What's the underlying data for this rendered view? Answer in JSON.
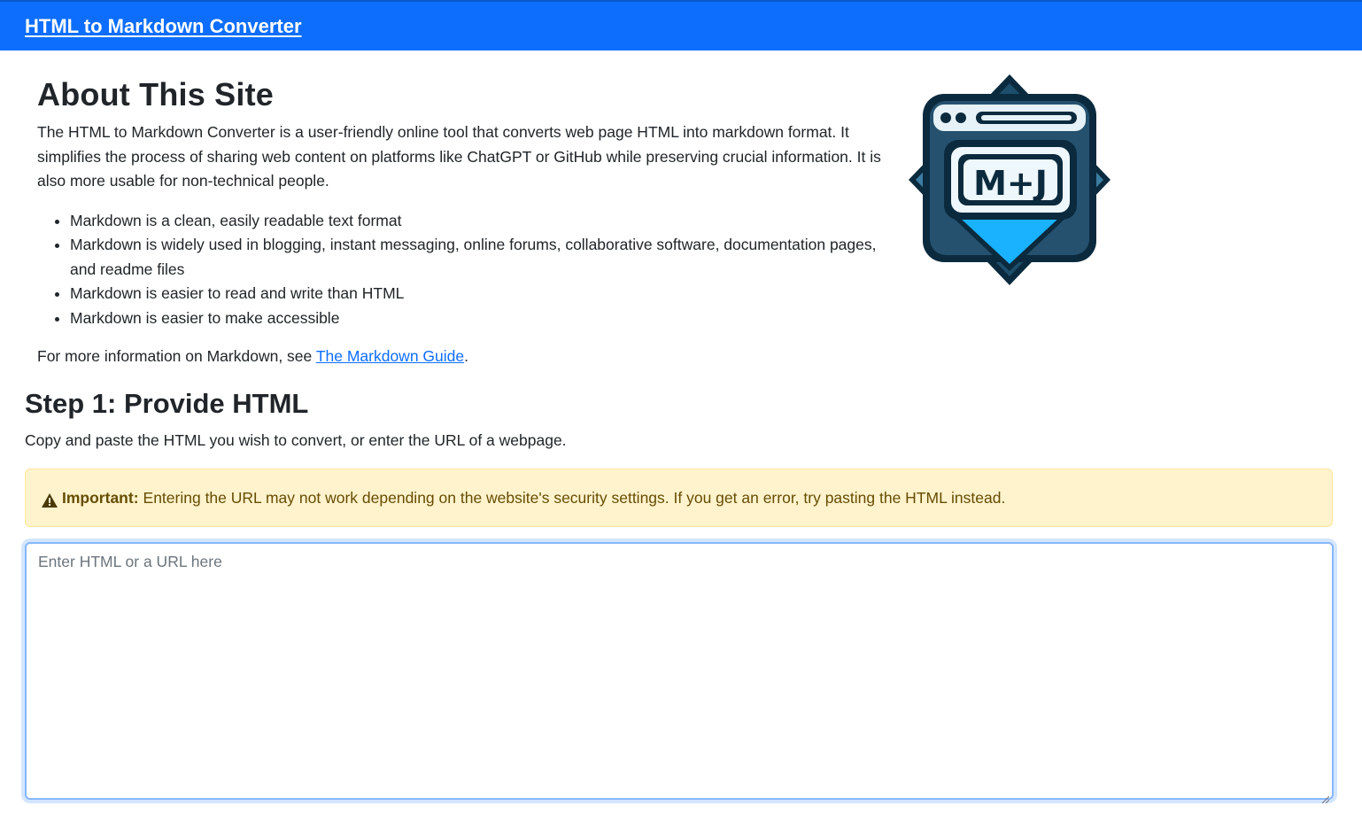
{
  "navbar": {
    "title": "HTML to Markdown Converter"
  },
  "about": {
    "heading": "About This Site",
    "intro": "The HTML to Markdown Converter is a user-friendly online tool that converts web page HTML into markdown format. It simplifies the process of sharing web content on platforms like ChatGPT or GitHub while preserving crucial information. It is also more usable for non-technical people.",
    "bullets": [
      "Markdown is a clean, easily readable text format",
      "Markdown is widely used in blogging, instant messaging, online forums, collaborative software, documentation pages, and readme files",
      "Markdown is easier to read and write than HTML",
      "Markdown is easier to make accessible"
    ],
    "more_info_prefix": "For more information on Markdown, see ",
    "more_info_link": "The Markdown Guide",
    "more_info_suffix": "."
  },
  "logo": {
    "icon": "markdown-logo-icon",
    "text": "M+J"
  },
  "step1": {
    "heading": "Step 1: Provide HTML",
    "description": "Copy and paste the HTML you wish to convert, or enter the URL of a webpage.",
    "alert": {
      "icon": "warning-triangle-icon",
      "label": "Important:",
      "text": "Entering the URL may not work depending on the website's security settings. If you get an error, try pasting the HTML instead."
    },
    "input": {
      "placeholder": "Enter HTML or a URL here",
      "value": ""
    }
  },
  "colors": {
    "primary": "#0d6efd",
    "alert_bg": "#fff3cd",
    "alert_text": "#664d03",
    "focus_border": "#86b7fe"
  }
}
